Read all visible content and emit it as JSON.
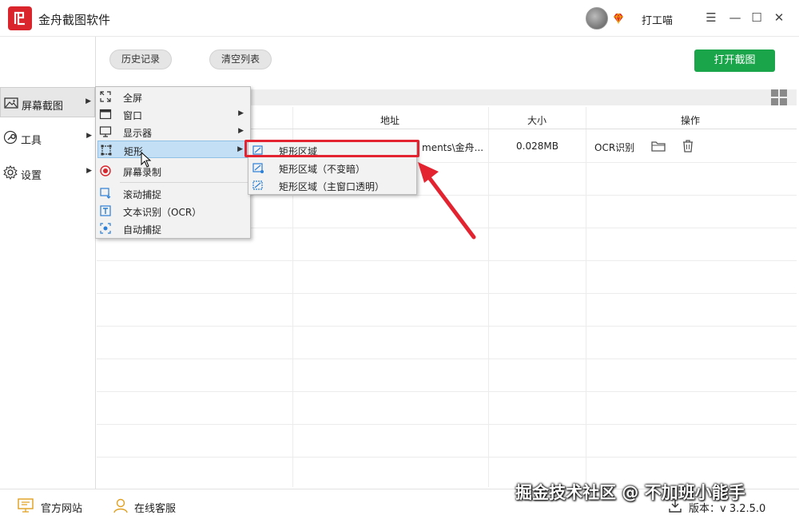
{
  "app": {
    "title": "金舟截图软件",
    "username": "打工喵"
  },
  "colors": {
    "accent": "#1aa54a",
    "brand": "#d9252b",
    "annotation": "#e32330",
    "menu_highlight": "#c3dff5"
  },
  "sidebar": {
    "items": [
      {
        "label": "屏幕截图",
        "icon": "image-icon"
      },
      {
        "label": "工具",
        "icon": "wrench-icon"
      },
      {
        "label": "设置",
        "icon": "gear-icon"
      }
    ]
  },
  "toolbar": {
    "history_label": "历史记录",
    "clear_label": "清空列表",
    "open_label": "打开截图"
  },
  "table": {
    "headers": [
      "地址",
      "大小",
      "操作"
    ],
    "rows": [
      {
        "address": "ments\\金舟...",
        "size": "0.028MB",
        "action": "OCR识别"
      }
    ]
  },
  "menu": {
    "items": [
      {
        "label": "全屏",
        "icon": "fullscreen-icon"
      },
      {
        "label": "窗口",
        "icon": "window-icon"
      },
      {
        "label": "显示器",
        "icon": "monitor-icon"
      },
      {
        "label": "矩形",
        "icon": "rectangle-icon"
      },
      {
        "label": "屏幕录制",
        "icon": "record-icon"
      },
      {
        "label": "滚动捕捉",
        "icon": "scroll-capture-icon"
      },
      {
        "label": "文本识别（OCR）",
        "icon": "ocr-icon"
      },
      {
        "label": "自动捕捉",
        "icon": "auto-capture-icon"
      }
    ]
  },
  "submenu": {
    "items": [
      {
        "label": "矩形区域",
        "icon": "rect-region-icon"
      },
      {
        "label": "矩形区域（不变暗）",
        "icon": "rect-region-bright-icon"
      },
      {
        "label": "矩形区域（主窗口透明）",
        "icon": "rect-region-transparent-icon"
      }
    ]
  },
  "footer": {
    "website": "官方网站",
    "support": "在线客服",
    "version": "版本：v 3.2.5.0"
  },
  "watermark": "掘金技术社区 @ 不加班小能手"
}
